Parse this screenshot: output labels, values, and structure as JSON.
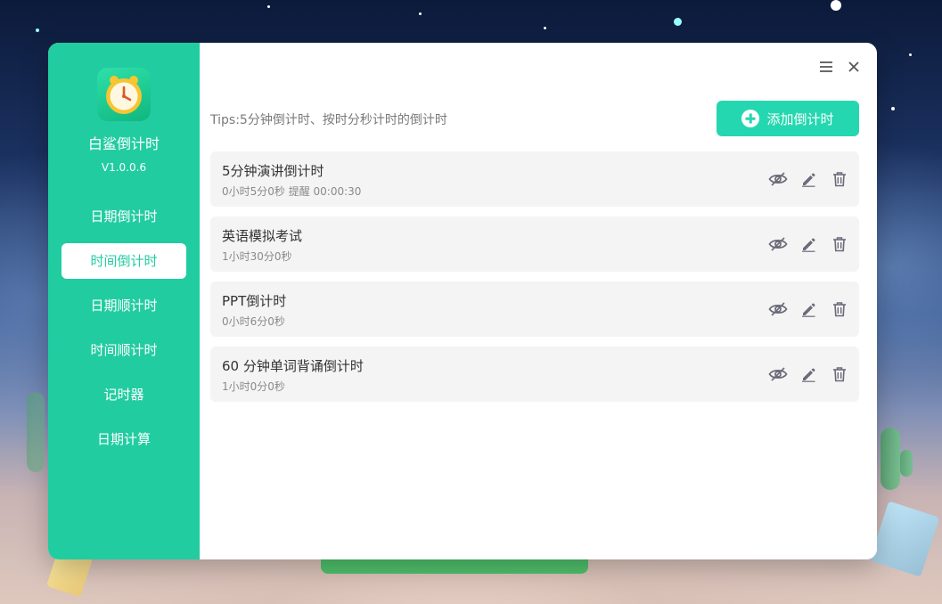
{
  "app": {
    "name": "白鲨倒计时",
    "version": "V1.0.0.6"
  },
  "sidebar": {
    "items": [
      {
        "label": "日期倒计时",
        "active": false
      },
      {
        "label": "时间倒计时",
        "active": true
      },
      {
        "label": "日期顺计时",
        "active": false
      },
      {
        "label": "时间顺计时",
        "active": false
      },
      {
        "label": "记时器",
        "active": false
      },
      {
        "label": "日期计算",
        "active": false
      }
    ]
  },
  "window": {
    "menu_icon": "hamburger-menu-icon",
    "close_icon": "close-icon"
  },
  "main": {
    "tips": "Tips:5分钟倒计时、按时分秒计时的倒计时",
    "add_button": "添加倒计时",
    "timers": [
      {
        "title": "5分钟演讲倒计时",
        "subtitle": "0小时5分0秒 提醒 00:00:30"
      },
      {
        "title": "英语模拟考试",
        "subtitle": "1小时30分0秒"
      },
      {
        "title": "PPT倒计时",
        "subtitle": "0小时6分0秒"
      },
      {
        "title": "60 分钟单词背诵倒计时",
        "subtitle": "1小时0分0秒"
      }
    ]
  },
  "colors": {
    "accent": "#22cca1",
    "button": "#25d7b0",
    "card": "#f4f4f4",
    "icon": "#6b6b7a"
  }
}
